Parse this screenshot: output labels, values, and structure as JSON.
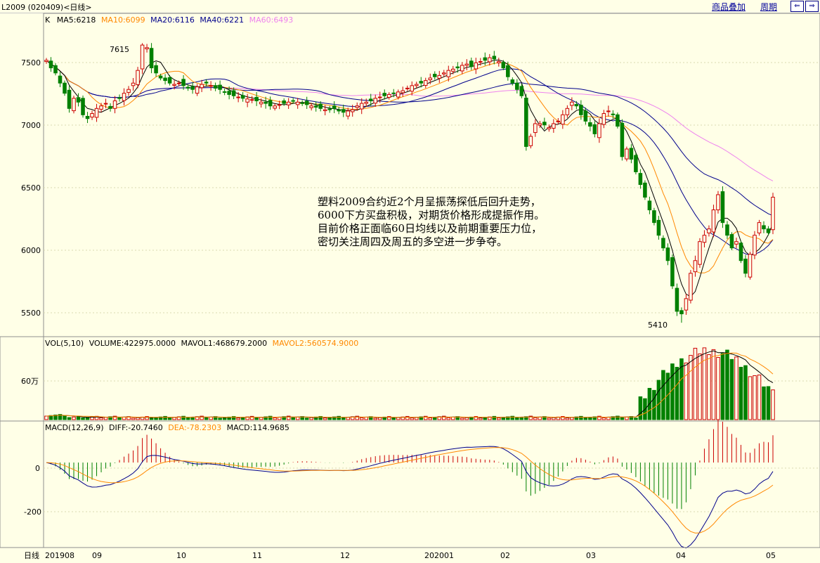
{
  "header": {
    "symbol": "L2009 (020409)<日线>",
    "overlay_label": "商品叠加",
    "period_label": "周期",
    "nav_prev": "⇐",
    "nav_next": "⇒"
  },
  "colors": {
    "up": "#cc0000",
    "down": "#008000",
    "ma5": "#000000",
    "ma10": "#ff8800",
    "ma20": "#00008b",
    "ma40": "#00008b",
    "ma60": "#ee82ee",
    "grid": "#c8c8a0"
  },
  "panels": {
    "price": {
      "legend_k": "K",
      "legend": [
        {
          "text": "MA5:6218",
          "color": "#000000"
        },
        {
          "text": "MA10:6099",
          "color": "#ff8800"
        },
        {
          "text": "MA20:6116",
          "color": "#00008b"
        },
        {
          "text": "MA40:6221",
          "color": "#00008b"
        },
        {
          "text": "MA60:6493",
          "color": "#ee82ee"
        }
      ],
      "yticks": [
        "7500",
        "7000",
        "6500",
        "6000",
        "5500"
      ],
      "high_label": "7615",
      "low_label": "5410",
      "note": [
        "塑料2009合约近2个月呈振荡探低后回升走势，",
        "6000下方买盘积极，对期货价格形成提振作用。",
        "目前价格正面临60日均线以及前期重要压力位，",
        "密切关注周四及周五的多空进一步争夺。"
      ]
    },
    "volume": {
      "legend": [
        {
          "text": "VOL(5,10)",
          "color": "#000000"
        },
        {
          "text": "VOLUME:422975.0000",
          "color": "#000000"
        },
        {
          "text": "MAVOL1:468679.2000",
          "color": "#000000"
        },
        {
          "text": "MAVOL2:560574.9000",
          "color": "#ff8800"
        }
      ],
      "ytick": "60万"
    },
    "macd": {
      "legend": [
        {
          "text": "MACD(12,26,9)",
          "color": "#000000"
        },
        {
          "text": "DIFF:-20.7460",
          "color": "#000000"
        },
        {
          "text": "DEA:-78.2303",
          "color": "#ff8800"
        },
        {
          "text": "MACD:114.9685",
          "color": "#000000"
        }
      ],
      "yticks": [
        "0",
        "-200"
      ]
    }
  },
  "x_axis": {
    "corner_label": "日线",
    "labels": [
      "201908",
      "09",
      "10",
      "11",
      "12",
      "202001",
      "02",
      "03",
      "04",
      "05"
    ]
  },
  "chart_data": {
    "type": "candlestick",
    "price_axis": {
      "ylim": [
        5300,
        7850
      ]
    },
    "close": [
      7480,
      7420,
      7380,
      7300,
      7220,
      7100,
      7180,
      7150,
      7050,
      7020,
      7060,
      7100,
      7120,
      7140,
      7100,
      7160,
      7180,
      7220,
      7250,
      7300,
      7400,
      7600,
      7580,
      7420,
      7380,
      7340,
      7320,
      7300,
      7290,
      7300,
      7280,
      7260,
      7250,
      7270,
      7290,
      7300,
      7280,
      7260,
      7250,
      7230,
      7210,
      7200,
      7190,
      7180,
      7175,
      7170,
      7160,
      7150,
      7140,
      7120,
      7120,
      7130,
      7140,
      7150,
      7160,
      7150,
      7140,
      7130,
      7120,
      7110,
      7100,
      7090,
      7090,
      7100,
      7080,
      7070,
      7080,
      7090,
      7120,
      7140,
      7150,
      7160,
      7180,
      7190,
      7200,
      7210,
      7220,
      7230,
      7240,
      7260,
      7280,
      7290,
      7300,
      7320,
      7340,
      7350,
      7360,
      7380,
      7400,
      7410,
      7420,
      7440,
      7450,
      7430,
      7460,
      7470,
      7480,
      7500,
      7490,
      7470,
      7420,
      7350,
      7300,
      7250,
      7200,
      6800,
      6880,
      6980,
      6980,
      6970,
      6950,
      6980,
      7000,
      7050,
      7100,
      7150,
      7120,
      7050,
      7000,
      6960,
      6900,
      6980,
      7060,
      7080,
      7050,
      6960,
      6720,
      6780,
      6700,
      6600,
      6500,
      6400,
      6300,
      6200,
      6100,
      6000,
      5900,
      5700,
      5500,
      5480,
      5600,
      5800,
      5900,
      6050,
      6100,
      6150,
      6300,
      6420,
      6200,
      6100,
      6000,
      6050,
      5900,
      5800,
      5950,
      6100,
      6200,
      6150,
      6120,
      6400
    ],
    "volume_axis": {
      "max": 1100000,
      "tick": 600000
    },
    "macd_axis": {
      "ylim": [
        -375,
        180
      ]
    },
    "ma_legend": {
      "MA5": 6218,
      "MA10": 6099,
      "MA20": 6116,
      "MA40": 6221,
      "MA60": 6493
    },
    "last_volume": 422975,
    "high": 7615,
    "low": 5410
  }
}
